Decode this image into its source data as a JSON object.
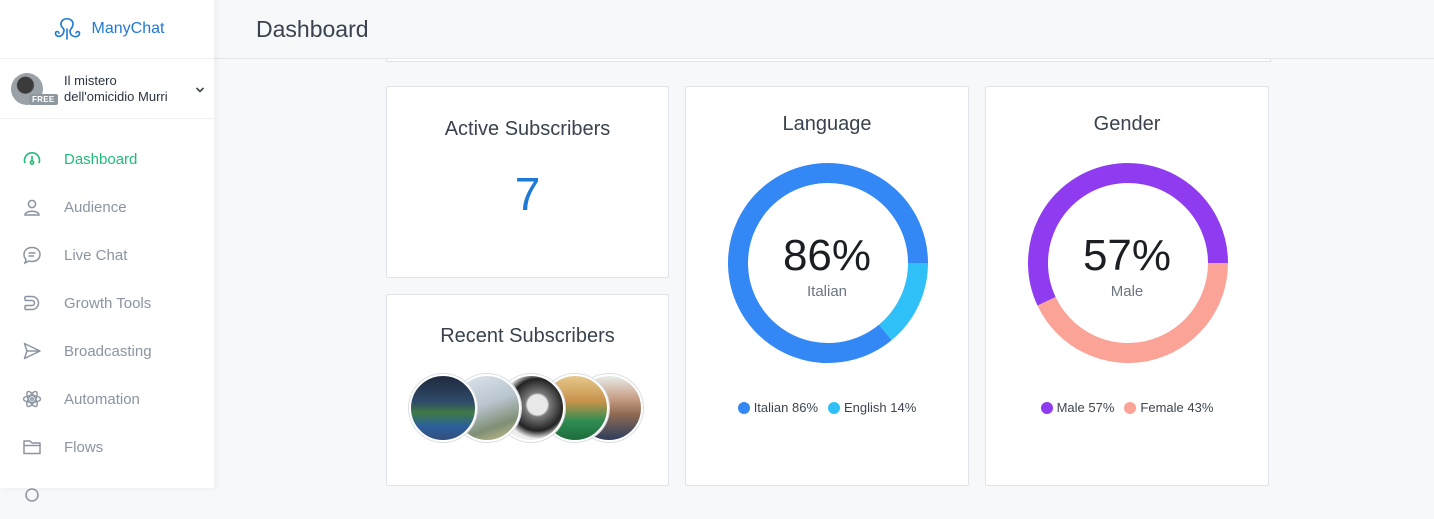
{
  "brand": {
    "name": "ManyChat",
    "color": "#1f7ad6"
  },
  "account": {
    "name": "Il mistero dell'omicidio Murri",
    "badge": "FREE"
  },
  "nav": [
    {
      "label": "Dashboard",
      "icon": "dashboard-gauge-icon",
      "active": true
    },
    {
      "label": "Audience",
      "icon": "person-icon",
      "active": false
    },
    {
      "label": "Live Chat",
      "icon": "chat-bubble-icon",
      "active": false
    },
    {
      "label": "Growth Tools",
      "icon": "magnet-icon",
      "active": false
    },
    {
      "label": "Broadcasting",
      "icon": "paper-plane-icon",
      "active": false
    },
    {
      "label": "Automation",
      "icon": "atom-icon",
      "active": false
    },
    {
      "label": "Flows",
      "icon": "folder-icon",
      "active": false
    }
  ],
  "header": {
    "title": "Dashboard"
  },
  "active_subscribers": {
    "title": "Active Subscribers",
    "value": "7"
  },
  "recent_subscribers": {
    "title": "Recent Subscribers",
    "avatars": [
      "subscriber-avatar-1",
      "subscriber-avatar-2",
      "subscriber-avatar-3",
      "subscriber-avatar-4",
      "subscriber-avatar-5"
    ]
  },
  "language": {
    "title": "Language",
    "percent": "86%",
    "label": "Italian",
    "segments": [
      {
        "name": "Italian",
        "value": 86,
        "color": "#3388f5",
        "legend": "Italian 86%"
      },
      {
        "name": "English",
        "value": 14,
        "color": "#30c0f8",
        "legend": "English 14%"
      }
    ]
  },
  "gender": {
    "title": "Gender",
    "percent": "57%",
    "label": "Male",
    "segments": [
      {
        "name": "Male",
        "value": 57,
        "color": "#8f3cf0",
        "legend": "Male 57%"
      },
      {
        "name": "Female",
        "value": 43,
        "color": "#fca397",
        "legend": "Female 43%"
      }
    ]
  },
  "colors": {
    "accent_active": "#20bc78",
    "nav_text": "#8a94a2"
  }
}
